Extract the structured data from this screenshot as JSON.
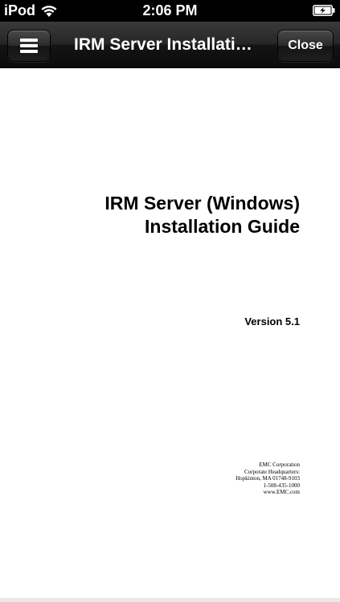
{
  "status_bar": {
    "carrier": "iPod",
    "time": "2:06 PM",
    "wifi_icon": "wifi-icon",
    "battery_icon": "battery-charging-icon"
  },
  "nav_bar": {
    "menu_icon": "menu-icon",
    "title": "IRM Server Installati…",
    "close_label": "Close"
  },
  "document": {
    "title_line1": "IRM Server (Windows)",
    "title_line2": "Installation Guide",
    "version": "Version 5.1",
    "address": [
      "EMC Corporation",
      "Corporate Headquarters:",
      "Hopkinton, MA 01748-9103",
      "1-508-435-1000",
      "www.EMC.com"
    ]
  }
}
